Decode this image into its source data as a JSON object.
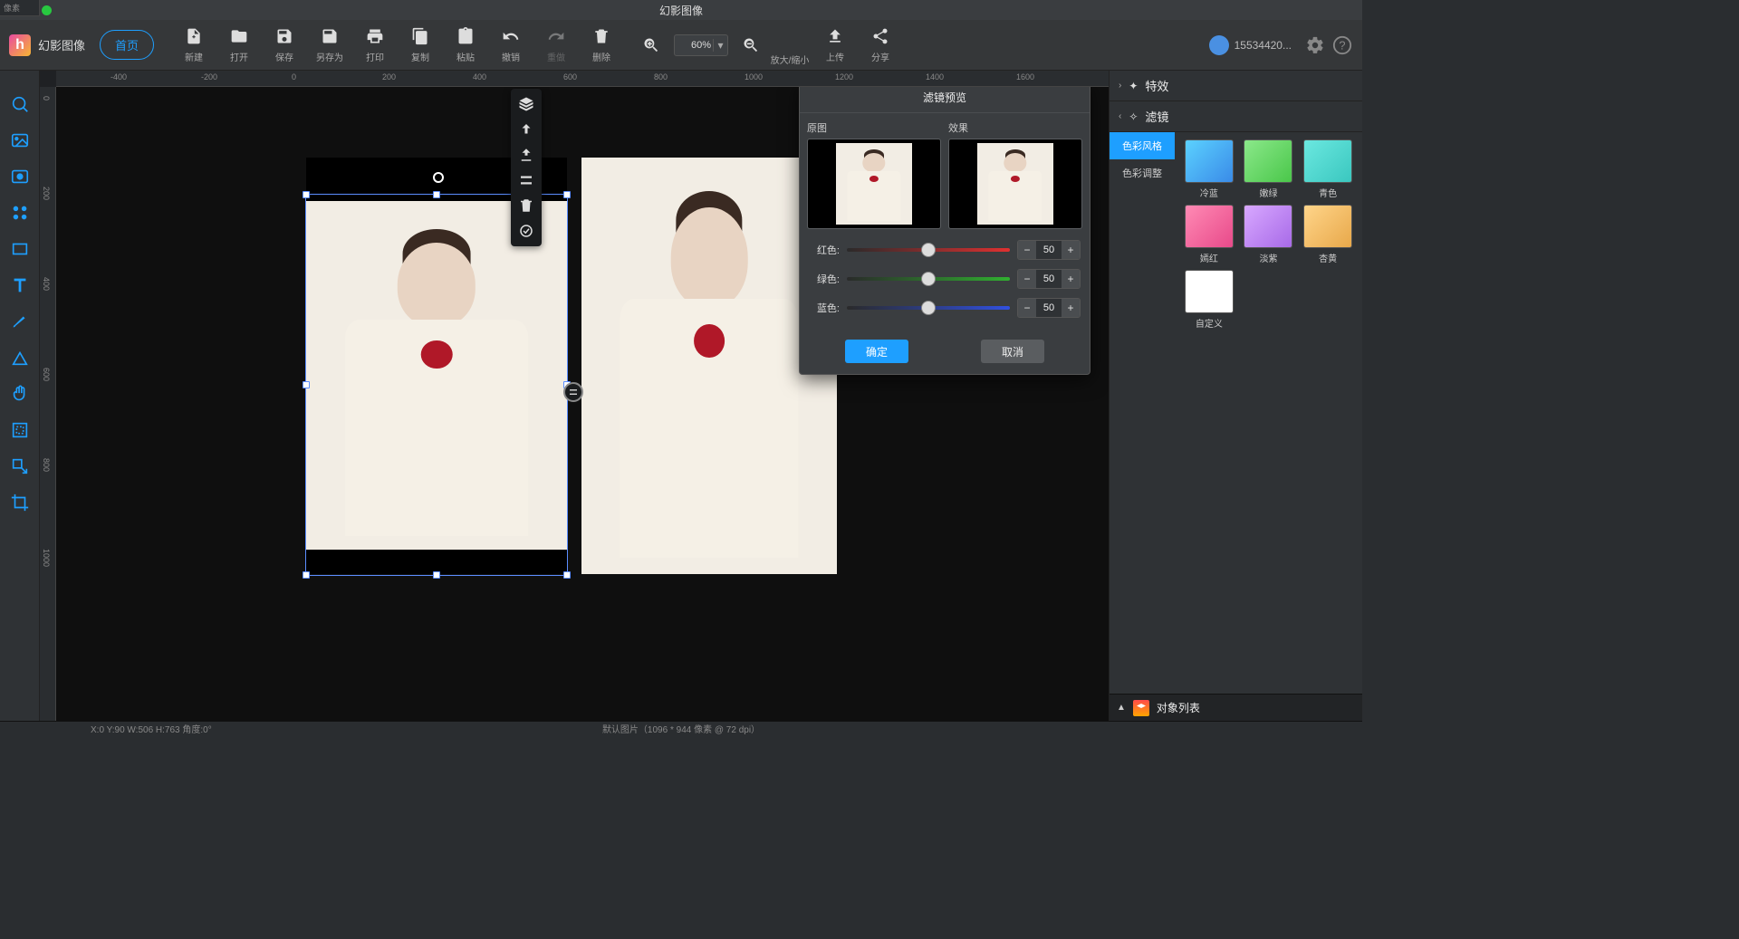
{
  "window": {
    "title": "幻影图像"
  },
  "brand": {
    "name": "幻影图像",
    "home": "首页"
  },
  "user": {
    "id": "15534420..."
  },
  "toolbar": [
    {
      "id": "new",
      "label": "新建"
    },
    {
      "id": "open",
      "label": "打开"
    },
    {
      "id": "save",
      "label": "保存"
    },
    {
      "id": "saveas",
      "label": "另存为"
    },
    {
      "id": "print",
      "label": "打印"
    },
    {
      "id": "copy",
      "label": "复制"
    },
    {
      "id": "paste",
      "label": "粘贴"
    },
    {
      "id": "undo",
      "label": "撤销"
    },
    {
      "id": "redo",
      "label": "重做"
    },
    {
      "id": "delete",
      "label": "删除"
    }
  ],
  "zoom": {
    "in": "",
    "out": "",
    "value": "60%",
    "label": "放大/缩小"
  },
  "upload_label": "上传",
  "share_label": "分享",
  "ruler_unit": "像素",
  "right": {
    "effects": "特效",
    "filters": "滤镜",
    "categories": [
      "色彩风格",
      "色彩调整"
    ],
    "thumbs": [
      "冷蓝",
      "嫩绿",
      "青色",
      "嫣红",
      "淡紫",
      "杏黄",
      "自定义"
    ],
    "objects_panel": "对象列表"
  },
  "panel": {
    "title": "滤镜预览",
    "original": "原图",
    "effect": "效果",
    "red": "红色:",
    "green": "绿色:",
    "blue": "蓝色:",
    "values": {
      "red": 50,
      "green": 50,
      "blue": 50
    },
    "ok": "确定",
    "cancel": "取消"
  },
  "status": {
    "coords": "X:0  Y:90  W:506  H:763  角度:0°",
    "doc": "默认图片（1096 * 944 像素 @ 72 dpi）"
  },
  "ruler_h": [
    -400,
    -200,
    0,
    200,
    400,
    600,
    800,
    1000,
    1200,
    1400,
    1600
  ],
  "ruler_v": [
    0,
    200,
    400,
    600,
    800,
    1000
  ]
}
